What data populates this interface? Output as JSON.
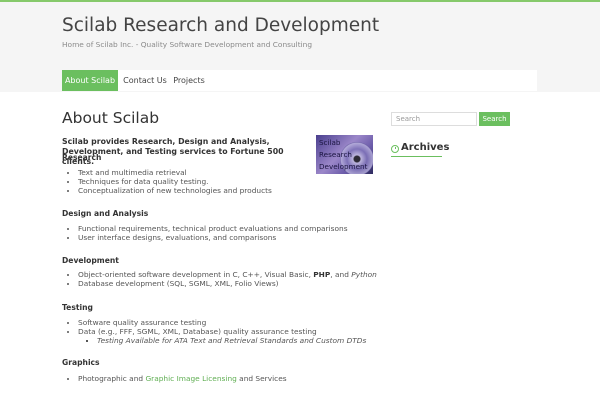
{
  "header": {
    "site_title": "Scilab Research and Development",
    "tagline": "Home of Scilab Inc. - Quality Software Development and Consulting"
  },
  "nav": {
    "items": [
      {
        "label": "About Scilab",
        "active": true
      },
      {
        "label": "Contact Us",
        "active": false
      },
      {
        "label": "Projects",
        "active": false
      }
    ]
  },
  "main": {
    "title": "About Scilab",
    "intro": "Scilab provides Research, Design and Analysis,  Development, and Testing services to Fortune 500 clients.",
    "thumbnail_text": [
      "Scilab",
      "Research",
      "Development"
    ],
    "sections": {
      "research": {
        "heading": "Research",
        "items": [
          "Text and multimedia retrieval",
          "Techniques for data quality testing.",
          "Conceptualization of new technologies and products"
        ]
      },
      "design": {
        "heading": "Design and Analysis",
        "items": [
          "Functional requirements, technical product evaluations and comparisons",
          "User interface designs, evaluations, and comparisons"
        ]
      },
      "development": {
        "heading": "Development",
        "item1_prefix": "Object-oriented software development in C, C++, Visual Basic, ",
        "item1_php": "PHP",
        "item1_and": ", and ",
        "item1_python": "Python",
        "item2": "Database development (SQL, SGML, XML, Folio Views)"
      },
      "testing": {
        "heading": "Testing",
        "items": [
          "Software quality assurance testing",
          "Data (e.g., FFF, SGML, XML, Database) quality assurance testing"
        ],
        "sub_item": "Testing Available for ATA Text and Retrieval Standards and Custom DTDs"
      },
      "graphics": {
        "heading": "Graphics",
        "prefix": "Photographic and ",
        "link": "Graphic Image Licensing",
        "suffix": " and Services"
      }
    }
  },
  "sidebar": {
    "search_placeholder": "Search",
    "search_button": "Search",
    "archives_title": "Archives"
  },
  "colors": {
    "accent": "#6bbf5f",
    "header_bg": "#f5f5f5"
  }
}
